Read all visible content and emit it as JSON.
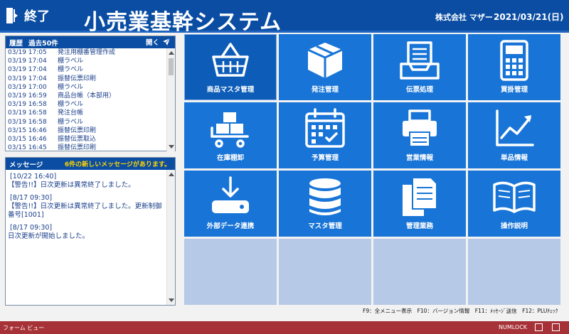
{
  "header": {
    "exit_label": "終了",
    "title": "小売業基幹システム",
    "company": "株式会社 マザー",
    "date": "2021/03/21(日)"
  },
  "history": {
    "title": "履歴",
    "subtitle": "過去50件",
    "open_label": "開く",
    "items": [
      {
        "time": "03/19 17:05",
        "label": "発注用棚番管理作成"
      },
      {
        "time": "03/19 17:04",
        "label": "棚ラベル"
      },
      {
        "time": "03/19 17:04",
        "label": "棚ラベル"
      },
      {
        "time": "03/19 17:04",
        "label": "振替伝票印刷"
      },
      {
        "time": "03/19 17:00",
        "label": "棚ラベル"
      },
      {
        "time": "03/19 16:59",
        "label": "商品台帳（本部用）"
      },
      {
        "time": "03/19 16:58",
        "label": "棚ラベル"
      },
      {
        "time": "03/19 16:58",
        "label": "発注台帳"
      },
      {
        "time": "03/19 16:58",
        "label": "棚ラベル"
      },
      {
        "time": "03/15 16:46",
        "label": "振替伝票印刷"
      },
      {
        "time": "03/15 16:46",
        "label": "振替伝票取込"
      },
      {
        "time": "03/15 16:45",
        "label": "振替伝票印刷"
      }
    ]
  },
  "messages": {
    "title": "メッセージ",
    "notice": "6件の新しいメッセージがあります。",
    "items": [
      {
        "time": "[10/22 16:40]",
        "text": "【警告!!】日次更新は異常終了しました。"
      },
      {
        "time": "[8/17 09:30]",
        "text": "【警告!!】日次更新は異常終了しました。更新制御番号[1001]"
      },
      {
        "time": "[8/17 09:30]",
        "text": "日次更新が開始しました。"
      }
    ]
  },
  "tiles": [
    {
      "label": "商品マスタ管理",
      "icon": "basket-icon"
    },
    {
      "label": "発注管理",
      "icon": "box-icon"
    },
    {
      "label": "伝票処理",
      "icon": "document-tray-icon"
    },
    {
      "label": "買掛管理",
      "icon": "calculator-icon"
    },
    {
      "label": "在庫棚卸",
      "icon": "boxes-cart-icon"
    },
    {
      "label": "予算管理",
      "icon": "calendar-icon"
    },
    {
      "label": "営業情報",
      "icon": "printer-icon"
    },
    {
      "label": "単品情報",
      "icon": "line-chart-icon"
    },
    {
      "label": "外部データ連携",
      "icon": "download-drive-icon"
    },
    {
      "label": "マスタ管理",
      "icon": "database-icon"
    },
    {
      "label": "管理業務",
      "icon": "documents-icon"
    },
    {
      "label": "操作説明",
      "icon": "book-icon"
    }
  ],
  "function_keys": "F9：全メニュー表示　F10：バージョン情報　F11：ﾒｯｾｰｼﾞ送信　F12：PLUﾁｪｯｸ",
  "status_bar": {
    "left": "フォーム ビュー",
    "numlock": "NUMLOCK"
  },
  "colors": {
    "header_blue": "#0a4da3",
    "tile_blue": "#1875d7",
    "tile_empty": "#b6c9e6",
    "status_red": "#a63237",
    "notice_yellow": "#ffd400"
  }
}
